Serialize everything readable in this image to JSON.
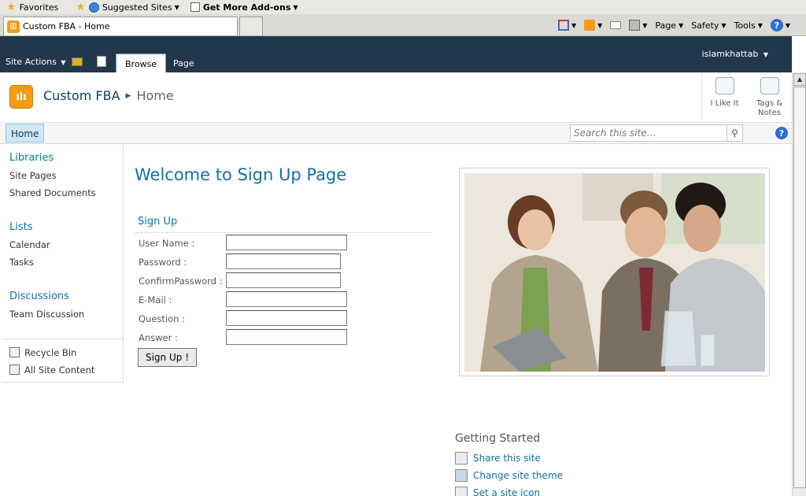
{
  "browser": {
    "favorites_label": "Favorites",
    "suggested_sites_label": "Suggested Sites",
    "get_addons_label": "Get More Add-ons",
    "tab_title": "Custom FBA - Home",
    "commands": {
      "page": "Page",
      "safety": "Safety",
      "tools": "Tools",
      "help": "?"
    }
  },
  "ribbon": {
    "site_actions": "Site Actions",
    "tabs": [
      {
        "label": "Browse"
      },
      {
        "label": "Page"
      }
    ],
    "user": "islamkhattab"
  },
  "header": {
    "logo_glyph": "ılı",
    "site_name": "Custom FBA",
    "current_page": "Home",
    "social": [
      {
        "label": "I Like It"
      },
      {
        "label": "Tags & Notes"
      }
    ]
  },
  "topnav": {
    "home": "Home",
    "search_placeholder": "Search this site...",
    "search_icon": "⚲",
    "help": "?"
  },
  "leftnav": {
    "libraries_header": "Libraries",
    "libraries": [
      "Site Pages",
      "Shared Documents"
    ],
    "lists_header": "Lists",
    "lists": [
      "Calendar",
      "Tasks"
    ],
    "discussions_header": "Discussions",
    "discussions": [
      "Team Discussion"
    ],
    "recycle_bin": "Recycle Bin",
    "all_site_content": "All Site Content"
  },
  "main": {
    "welcome": "Welcome to Sign Up Page",
    "signup_title": "Sign Up",
    "fields": {
      "username_label": "User Name :",
      "password_label": "Password :",
      "confirm_label": "ConfirmPassword :",
      "email_label": "E-Mail :",
      "question_label": "Question :",
      "answer_label": "Answer :"
    },
    "values": {
      "username": "",
      "password": "",
      "confirm": "",
      "email": "",
      "question": "",
      "answer": ""
    },
    "submit_label": "Sign Up !"
  },
  "getting_started": {
    "title": "Getting Started",
    "items": [
      "Share this site",
      "Change site theme",
      "Set a site icon"
    ]
  }
}
